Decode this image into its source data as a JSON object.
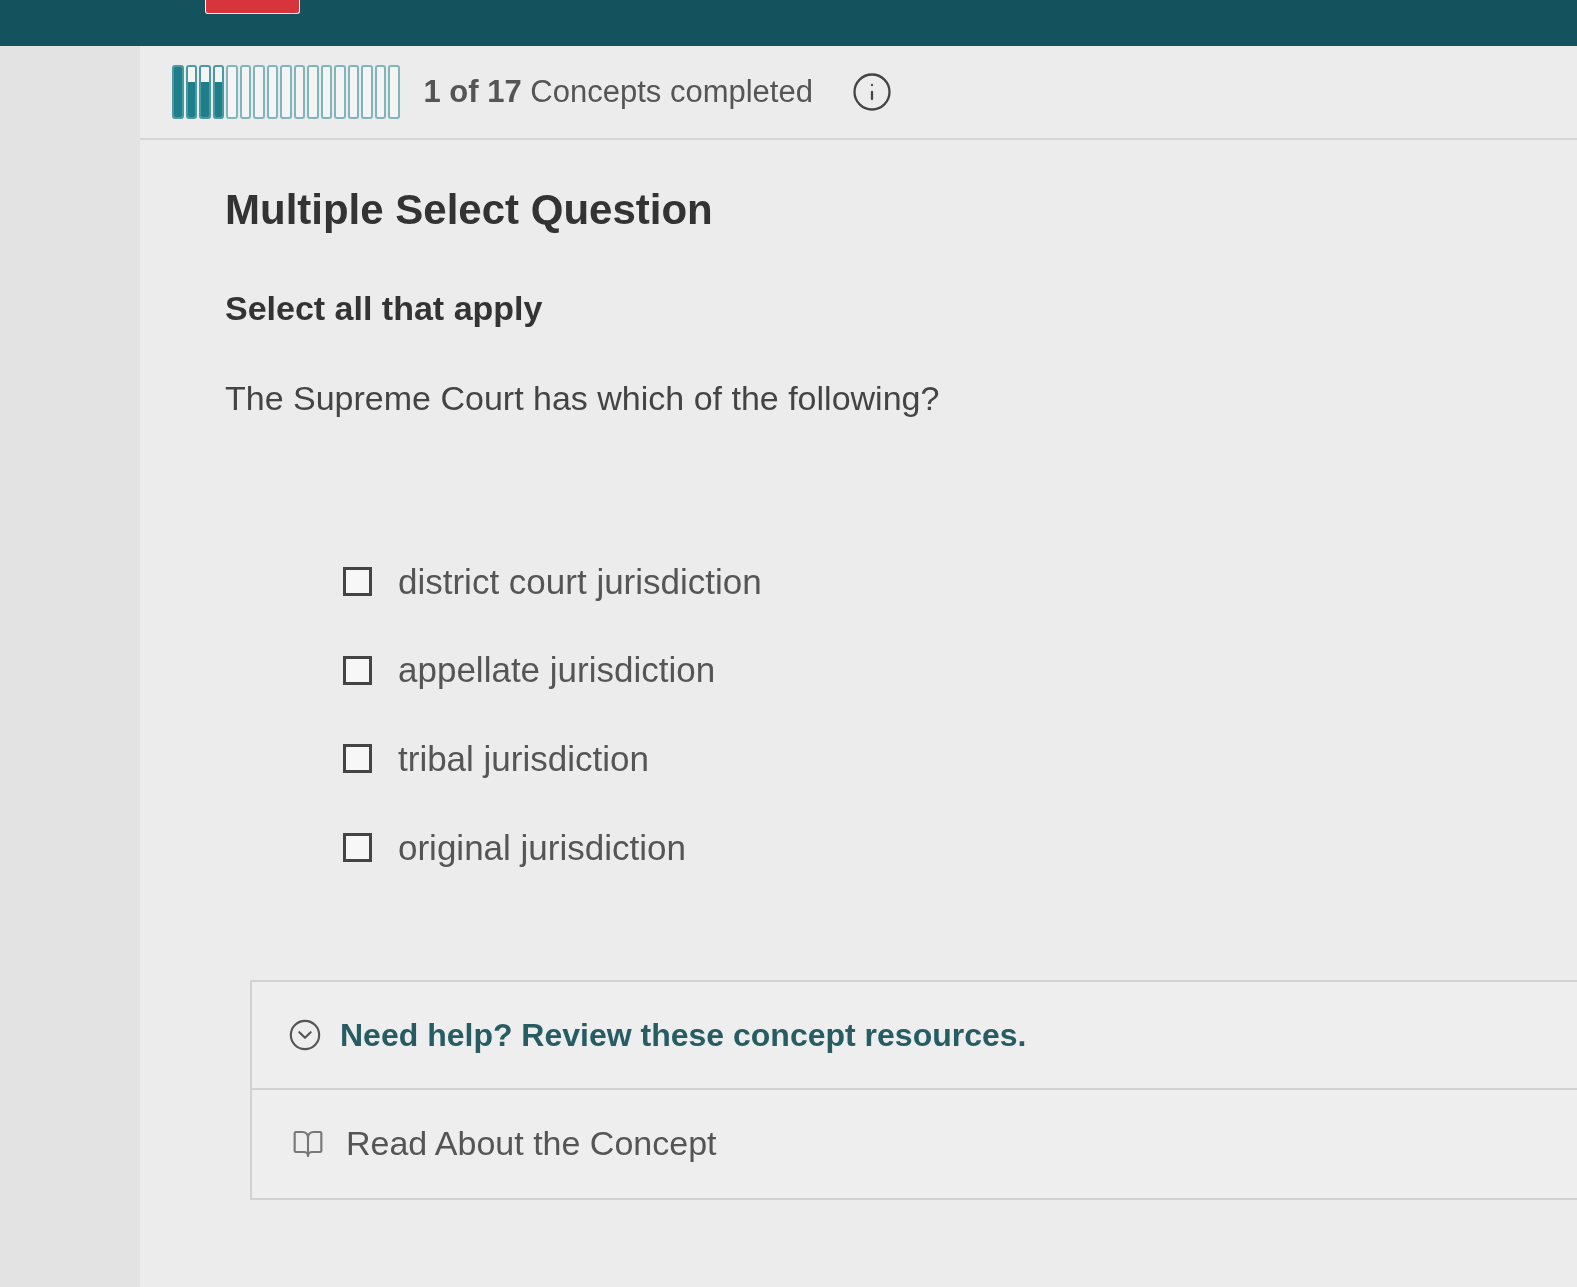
{
  "progress": {
    "segments": [
      {
        "kind": "filled",
        "level": 1
      },
      {
        "kind": "filled",
        "level": 0.7
      },
      {
        "kind": "filled",
        "level": 0.7
      },
      {
        "kind": "filled",
        "level": 0.7
      },
      {
        "kind": "empty"
      },
      {
        "kind": "empty"
      },
      {
        "kind": "empty"
      },
      {
        "kind": "empty"
      },
      {
        "kind": "empty"
      },
      {
        "kind": "empty"
      },
      {
        "kind": "empty"
      },
      {
        "kind": "empty"
      },
      {
        "kind": "empty"
      },
      {
        "kind": "empty"
      },
      {
        "kind": "empty"
      },
      {
        "kind": "empty"
      },
      {
        "kind": "empty"
      }
    ],
    "label": "**1 of 17** Concepts completed"
  },
  "question": {
    "type": "Multiple Select Question",
    "instruction": "Select all that apply",
    "prompt": "The Supreme Court has which of the following?",
    "options": [
      {
        "label": "district court jurisdiction",
        "checked": false
      },
      {
        "label": "appellate jurisdiction",
        "checked": false
      },
      {
        "label": "tribal jurisdiction",
        "checked": false
      },
      {
        "label": "original jurisdiction",
        "checked": false
      }
    ]
  },
  "help": {
    "title": "Need help? Review these concept resources.",
    "resources": [
      {
        "label": "Read About the Concept"
      }
    ]
  }
}
